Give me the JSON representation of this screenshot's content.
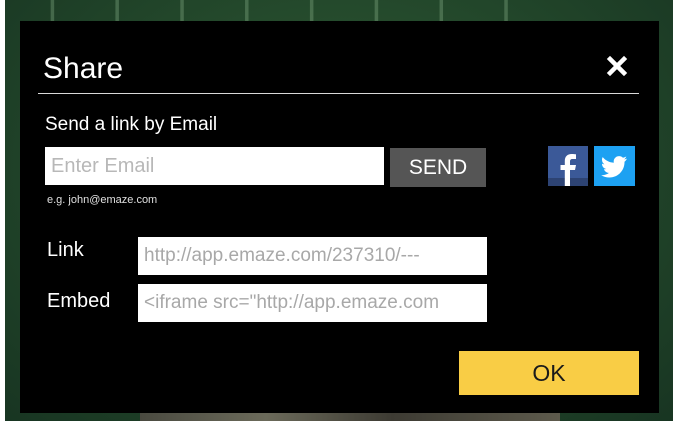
{
  "dialog": {
    "title": "Share",
    "close_icon": "close-icon"
  },
  "email": {
    "heading": "Send a link by Email",
    "placeholder": "Enter Email",
    "value": "",
    "send_label": "SEND",
    "hint": "e.g. john@emaze.com"
  },
  "social": {
    "facebook_icon": "facebook-icon",
    "twitter_icon": "twitter-icon",
    "facebook_color": "#3b5998",
    "twitter_color": "#1da1f2"
  },
  "link": {
    "label": "Link",
    "value": "http://app.emaze.com/237310/---"
  },
  "embed": {
    "label": "Embed",
    "value": "<iframe src=\"http://app.emaze.com"
  },
  "ok_label": "OK",
  "colors": {
    "modal_bg": "#000000",
    "ok_button": "#f9cd45",
    "send_button": "#555555"
  }
}
